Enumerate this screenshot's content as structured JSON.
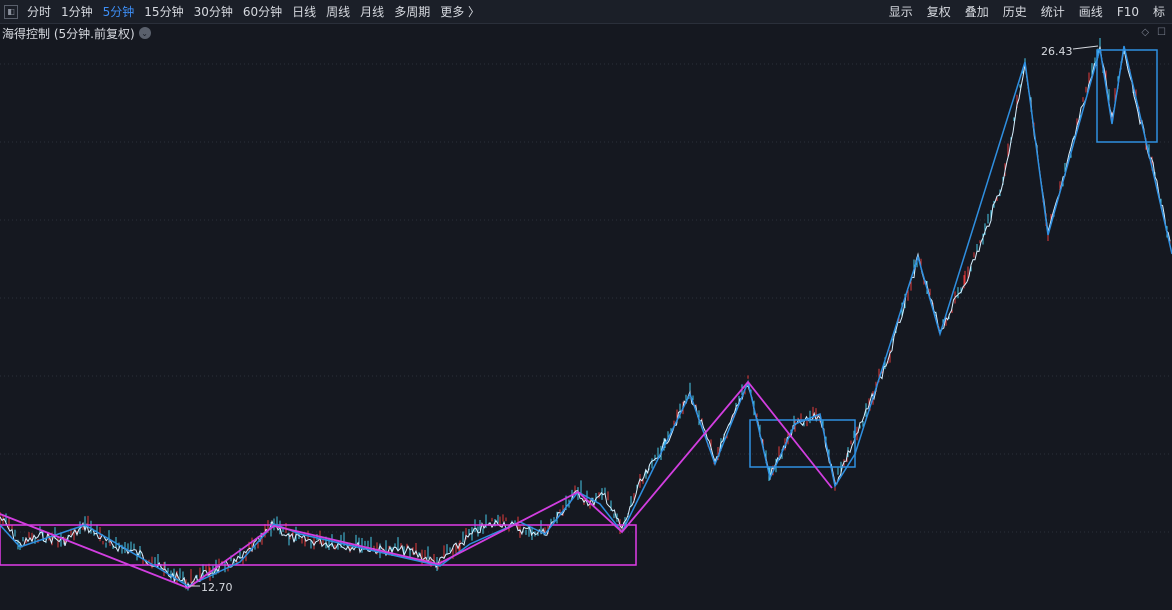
{
  "toolbar": {
    "collapse_glyph": "◧",
    "period_tabs": [
      {
        "label": "分时",
        "active": false
      },
      {
        "label": "1分钟",
        "active": false
      },
      {
        "label": "5分钟",
        "active": true
      },
      {
        "label": "15分钟",
        "active": false
      },
      {
        "label": "30分钟",
        "active": false
      },
      {
        "label": "60分钟",
        "active": false
      },
      {
        "label": "日线",
        "active": false
      },
      {
        "label": "周线",
        "active": false
      },
      {
        "label": "月线",
        "active": false
      },
      {
        "label": "多周期",
        "active": false
      },
      {
        "label": "更多 〉",
        "active": false
      }
    ],
    "right_tools": [
      "显示",
      "复权",
      "叠加",
      "历史",
      "统计",
      "画线",
      "F10",
      "标"
    ]
  },
  "stock_title": {
    "text": "海得控制 (5分钟.前复权)",
    "dropdown_glyph": "⌄"
  },
  "corner_icons": [
    "◇",
    "☐"
  ],
  "chart_annotations": {
    "high_label": "26.43",
    "low_label": "12.70"
  },
  "colors": {
    "background": "#151820",
    "up_candle": "#e23b3b",
    "down_candle": "#48c8e8",
    "price_line": "#d8f0ff",
    "zigzag_blue": "#2f8fe0",
    "zigzag_magenta": "#d23ee0",
    "box_magenta": "#e03ce8",
    "box_blue": "#2f8fe0",
    "grid": "#2a2f3a"
  }
}
